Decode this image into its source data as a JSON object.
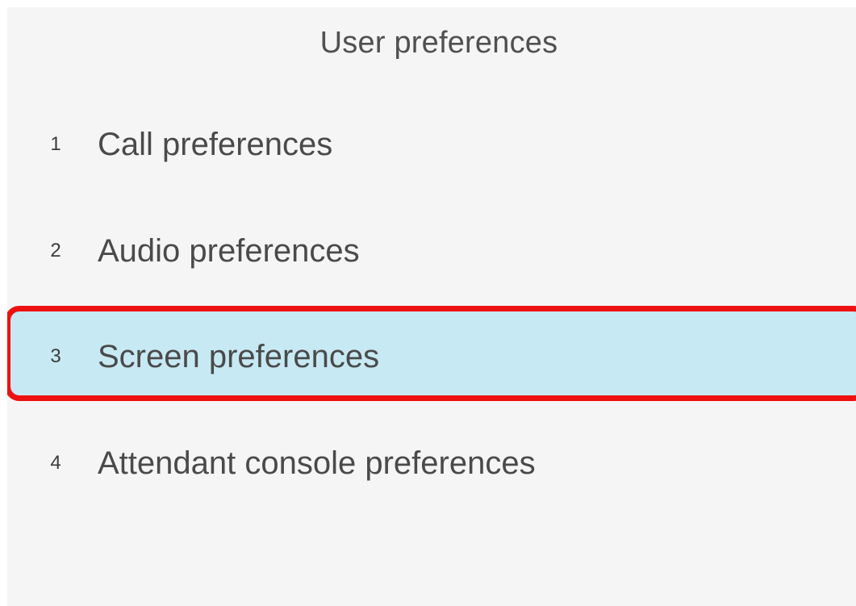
{
  "header": {
    "title": "User preferences"
  },
  "menu": {
    "items": [
      {
        "number": "1",
        "label": "Call preferences",
        "selected": false
      },
      {
        "number": "2",
        "label": "Audio preferences",
        "selected": false
      },
      {
        "number": "3",
        "label": "Screen preferences",
        "selected": true
      },
      {
        "number": "4",
        "label": "Attendant console preferences",
        "selected": false
      }
    ]
  },
  "colors": {
    "background": "#f5f5f5",
    "selected_background": "#c7e9f3",
    "highlight_outline": "#ee1111",
    "text": "#4a4a4a"
  }
}
